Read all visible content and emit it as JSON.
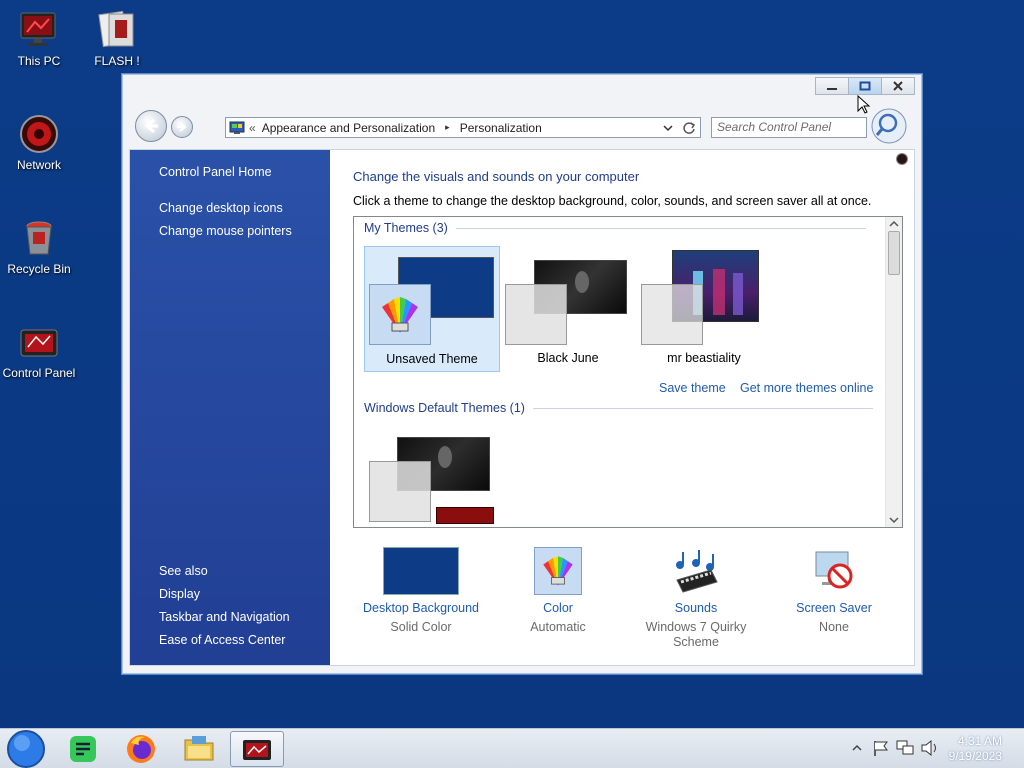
{
  "desktop": {
    "icons": [
      {
        "label": "This PC"
      },
      {
        "label": "FLASH !"
      },
      {
        "label": "Network"
      },
      {
        "label": "Recycle Bin"
      },
      {
        "label": "Control Panel"
      }
    ]
  },
  "window": {
    "breadcrumb": {
      "overflow": "«",
      "items": [
        "Appearance and Personalization",
        "Personalization"
      ],
      "separator": "▸"
    },
    "search_placeholder": "Search Control Panel",
    "sidebar": {
      "links": [
        "Control Panel Home",
        "Change desktop icons",
        "Change mouse pointers"
      ],
      "see_also_label": "See also",
      "see_also": [
        "Display",
        "Taskbar and Navigation",
        "Ease of Access Center"
      ]
    },
    "main": {
      "heading": "Change the visuals and sounds on your computer",
      "subheading": "Click a theme to change the desktop background, color, sounds, and screen saver all at once.",
      "my_themes_header": "My Themes (3)",
      "my_themes": [
        {
          "name": "Unsaved Theme",
          "selected": true
        },
        {
          "name": "Black June",
          "selected": false
        },
        {
          "name": "mr beastiality",
          "selected": false
        }
      ],
      "save_theme": "Save theme",
      "get_more_themes": "Get more themes online",
      "default_header": "Windows Default Themes (1)"
    },
    "bottom_bar": [
      {
        "title": "Desktop Background",
        "subtitle": "Solid Color"
      },
      {
        "title": "Color",
        "subtitle": "Automatic"
      },
      {
        "title": "Sounds",
        "subtitle": "Windows 7 Quirky Scheme"
      },
      {
        "title": "Screen Saver",
        "subtitle": "None"
      }
    ]
  },
  "taskbar": {
    "clock_time": "4:31 AM",
    "clock_date": "9/19/2023"
  },
  "colors": {
    "desktop": "#0b3a86",
    "sidebar": "#2a51a8",
    "link": "#1f5bb0",
    "heading": "#1f3d8e",
    "solid_color_swatch": "#0d3b86"
  }
}
